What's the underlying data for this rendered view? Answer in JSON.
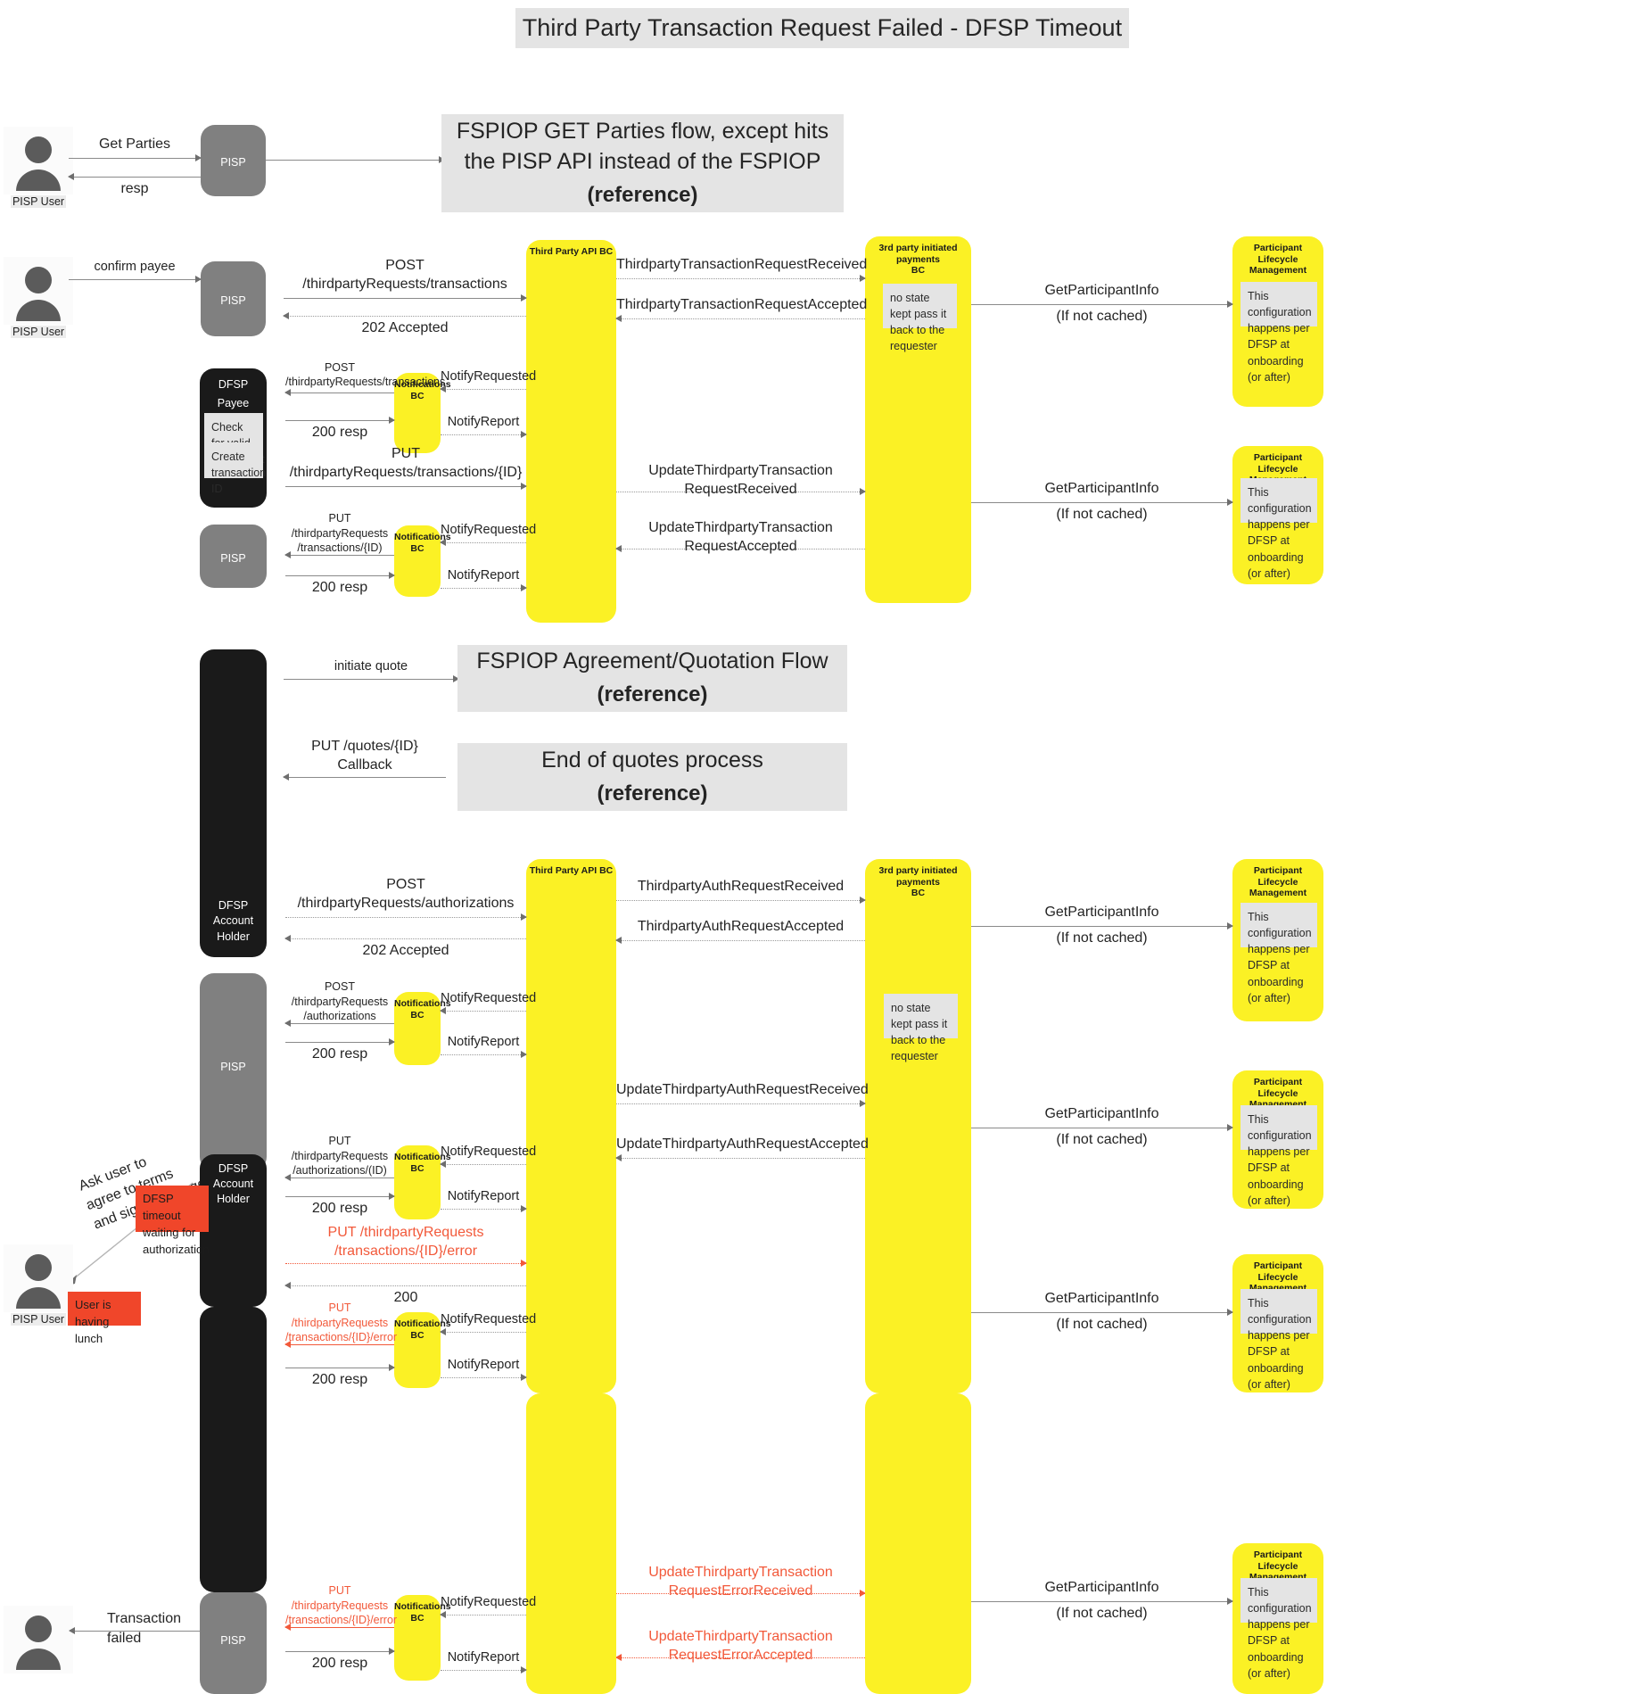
{
  "title": "Third Party Transaction Request Failed - DFSP Timeout",
  "colors": {
    "yellow": "#fbf125",
    "grey_lane": "#808080",
    "black_lane": "#1a1a1a",
    "note_grey": "#e4e4e4",
    "note_red": "#f0462a",
    "error_text": "#f2593a"
  },
  "actors": {
    "pisp_user": "PISP User",
    "pisp": "PISP",
    "dfsp_payee_line1": "DFSP",
    "dfsp_payee_line2": "Payee",
    "dfsp_account_holder_line1": "DFSP",
    "dfsp_account_holder_line2": "Account Holder",
    "third_party_api_bc": "Third Party API BC",
    "notifications_bc": "Notifications\nBC",
    "third_party_payments_bc": "3rd party initiated payments\nBC",
    "participant_lifecycle": "Participant Lifecycle\nManagement"
  },
  "references": {
    "get_parties_main": "FSPIOP GET Parties flow, except hits the PISP API instead of the FSPIOP",
    "get_parties_sub": "(reference)",
    "quotation_main": "FSPIOP Agreement/Quotation Flow",
    "quotation_sub": "(reference)",
    "end_quotes_main": "End of quotes process",
    "end_quotes_sub": "(reference)"
  },
  "notes": {
    "no_state_kept": "no state kept\npass it back to the\nrequester",
    "plm_config": "This configuration\nhappens per DFSP at\nonboarding (or after)",
    "check_valid_agreement": "Check for valid\nagreement",
    "create_transaction_id": "Create\ntransaction ID",
    "user_having_lunch": "User is having\nlunch",
    "dfsp_timeout": "DFSP timeout\nwaiting for\nauthorization",
    "ask_user": "Ask user to\nagree to terms\nand sign challenge"
  },
  "messages": {
    "get_parties": "Get Parties",
    "resp": "resp",
    "confirm_payee": "confirm payee",
    "post_tpr_transactions": "POST /thirdpartyRequests/transactions",
    "accepted_202": "202 Accepted",
    "tp_txn_req_received": "ThirdpartyTransactionRequestReceived",
    "tp_txn_req_accepted": "ThirdpartyTransactionRequestAccepted",
    "get_participant_info": "GetParticipantInfo",
    "if_not_cached": "(If not cached)",
    "post_tpr_transactions_small": "POST /thirdpartyRequests/transactions",
    "notify_requested": "NotifyRequested",
    "notify_report": "NotifyReport",
    "resp_200": "200 resp",
    "put_tpr_transactions_id": "PUT /thirdpartyRequests/transactions/{ID}",
    "update_tp_txn_req_received": "UpdateThirdpartyTransaction\nRequestReceived",
    "update_tp_txn_req_accepted": "UpdateThirdpartyTransaction\nRequestAccepted",
    "put_tpr_transactions_id_wrapped": "PUT /thirdpartyRequests\n/transactions/{ID)",
    "initiate_quote": "initiate quote",
    "put_quotes_callback": "PUT /quotes/{ID}\nCallback",
    "post_tpr_authorizations": "POST /thirdpartyRequests/authorizations",
    "tp_auth_req_received": "ThirdpartyAuthRequestReceived",
    "tp_auth_req_accepted": "ThirdpartyAuthRequestAccepted",
    "post_tpr_authorizations_wrapped": "POST /thirdpartyRequests\n/authorizations",
    "update_tp_auth_req_received": "UpdateThirdpartyAuthRequestReceived",
    "update_tp_auth_req_accepted": "UpdateThirdpartyAuthRequestAccepted",
    "put_tpr_authorizations_id": "PUT /thirdpartyRequests\n/authorizations/(ID)",
    "put_tpr_transactions_error": "PUT /thirdpartyRequests\n/transactions/{ID}/error",
    "resp_plain_200": "200",
    "put_tpr_transactions_error_small": "PUT /thirdpartyRequests\n/transactions/{ID}/error",
    "update_tp_txn_req_error_received": "UpdateThirdpartyTransaction\nRequestErrorReceived",
    "update_tp_txn_req_error_accepted": "UpdateThirdpartyTransaction\nRequestErrorAccepted",
    "transaction_failed": "Transaction\nfailed"
  }
}
